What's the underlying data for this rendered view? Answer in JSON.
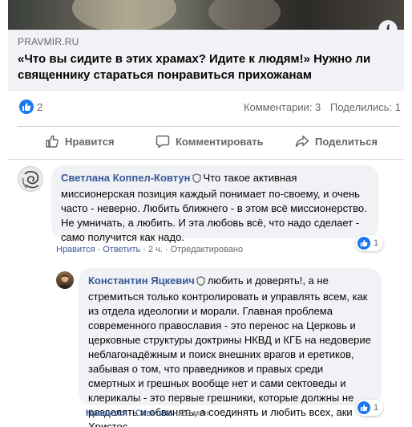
{
  "link_preview": {
    "source": "PRAVMIR.RU",
    "title": "«Что вы сидите в этих храмах? Идите к людям!» Нужно ли священнику стараться понравиться прихожанам",
    "info_icon": "info-icon"
  },
  "stats": {
    "likes": "2",
    "comments": "Комментарии: 3",
    "shares": "Поделились: 1"
  },
  "actions": {
    "like": "Нравится",
    "comment": "Комментировать",
    "share": "Поделиться"
  },
  "comments": [
    {
      "author": "Светлана Коппел-Ковтун",
      "text": "Что такое активная миссионерская позиция каждый понимает по-своему, и очень часто - неверно. Любить ближнего - в этом всё миссионерство. Не умничать, а любить. И эта любовь всё, что надо сделает - само получится как надо.",
      "like": "Нравится",
      "reply": "Ответить",
      "time": "2 ч.",
      "edited": "Отредактировано",
      "reactions": "1",
      "reply_comment": {
        "author": "Константин Яцкевич",
        "text": "любить и доверять!, а не стремиться только контролировать и управлять всем, как из отдела идеологии и морали. Главная проблема современного православия - это перенос на Церковь и церковные структуры доктрины НКВД и КГБ на недоверие неблагонадёжным и поиск внешних врагов и еретиков, забывая о том, что праведников и правых среди смертных и грешных вообще нет и сами сектоведы и клерикалы - это первые грешники, которые должны не разделять и обвинять, а соединять и любить всех, аки Христос.....",
        "like": "Нравится",
        "reply": "Ответить",
        "time": "29 мин.",
        "reactions": "1"
      }
    }
  ],
  "colors": {
    "brand_blue": "#1877f2",
    "author_link": "#385898",
    "secondary_text": "#65676b",
    "bubble_bg": "#f0f2f5"
  }
}
